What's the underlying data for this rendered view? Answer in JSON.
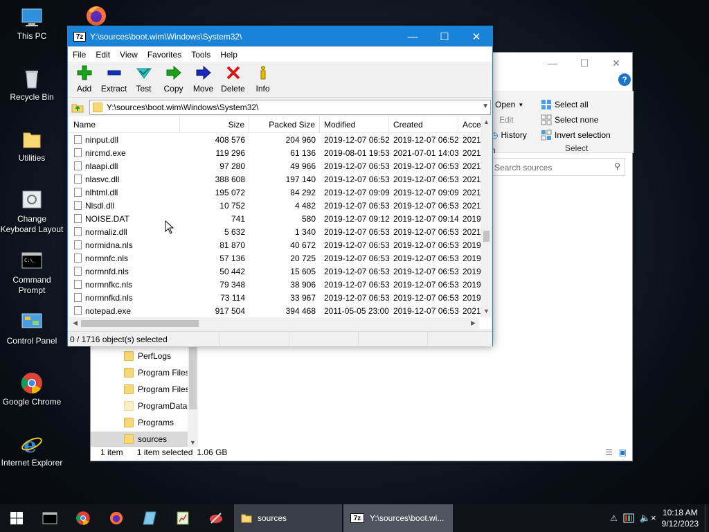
{
  "desktop": {
    "icons": [
      {
        "label": "This PC"
      },
      {
        "label": "Recycle Bin"
      },
      {
        "label": "Utilities"
      },
      {
        "label": "Change Keyboard Layout"
      },
      {
        "label": "Command Prompt"
      },
      {
        "label": "Control Panel"
      },
      {
        "label": "Google Chrome"
      },
      {
        "label": "Internet Explorer"
      }
    ]
  },
  "explorer": {
    "ribbon": {
      "open": "Open",
      "edit": "Edit",
      "history": "History",
      "select_all": "Select all",
      "select_none": "Select none",
      "invert_selection": "Invert selection",
      "group_select": "Select",
      "group_open_fragment": "n"
    },
    "search_placeholder": "Search sources",
    "tree": [
      "PerfLogs",
      "Program Files",
      "Program Files",
      "ProgramData",
      "Programs",
      "sources"
    ],
    "status": {
      "count": "1 item",
      "selected": "1 item selected",
      "size": "1.06 GB"
    }
  },
  "sevenzip": {
    "title": "Y:\\sources\\boot.wim\\Windows\\System32\\",
    "logo": "7z",
    "menu": [
      "File",
      "Edit",
      "View",
      "Favorites",
      "Tools",
      "Help"
    ],
    "toolbar": [
      "Add",
      "Extract",
      "Test",
      "Copy",
      "Move",
      "Delete",
      "Info"
    ],
    "address": "Y:\\sources\\boot.wim\\Windows\\System32\\",
    "columns": [
      "Name",
      "Size",
      "Packed Size",
      "Modified",
      "Created",
      "Acce"
    ],
    "rows": [
      {
        "name": "ninput.dll",
        "size": "408 576",
        "packed": "204 960",
        "modified": "2019-12-07 06:52",
        "created": "2019-12-07 06:52",
        "accessed": "2021-"
      },
      {
        "name": "nircmd.exe",
        "size": "119 296",
        "packed": "61 136",
        "modified": "2019-08-01 19:53",
        "created": "2021-07-01 14:03",
        "accessed": "2021-"
      },
      {
        "name": "nlaapi.dll",
        "size": "97 280",
        "packed": "49 966",
        "modified": "2019-12-07 06:53",
        "created": "2019-12-07 06:53",
        "accessed": "2021-"
      },
      {
        "name": "nlasvc.dll",
        "size": "388 608",
        "packed": "197 140",
        "modified": "2019-12-07 06:53",
        "created": "2019-12-07 06:53",
        "accessed": "2021-"
      },
      {
        "name": "nlhtml.dll",
        "size": "195 072",
        "packed": "84 292",
        "modified": "2019-12-07 09:09",
        "created": "2019-12-07 09:09",
        "accessed": "2021-"
      },
      {
        "name": "Nlsdl.dll",
        "size": "10 752",
        "packed": "4 482",
        "modified": "2019-12-07 06:53",
        "created": "2019-12-07 06:53",
        "accessed": "2021-"
      },
      {
        "name": "NOISE.DAT",
        "size": "741",
        "packed": "580",
        "modified": "2019-12-07 09:12",
        "created": "2019-12-07 09:14",
        "accessed": "2019-"
      },
      {
        "name": "normaliz.dll",
        "size": "5 632",
        "packed": "1 340",
        "modified": "2019-12-07 06:53",
        "created": "2019-12-07 06:53",
        "accessed": "2021-"
      },
      {
        "name": "normidna.nls",
        "size": "81 870",
        "packed": "40 672",
        "modified": "2019-12-07 06:53",
        "created": "2019-12-07 06:53",
        "accessed": "2019-"
      },
      {
        "name": "normnfc.nls",
        "size": "57 136",
        "packed": "20 725",
        "modified": "2019-12-07 06:53",
        "created": "2019-12-07 06:53",
        "accessed": "2019-"
      },
      {
        "name": "normnfd.nls",
        "size": "50 442",
        "packed": "15 605",
        "modified": "2019-12-07 06:53",
        "created": "2019-12-07 06:53",
        "accessed": "2019-"
      },
      {
        "name": "normnfkc.nls",
        "size": "79 348",
        "packed": "38 906",
        "modified": "2019-12-07 06:53",
        "created": "2019-12-07 06:53",
        "accessed": "2019-"
      },
      {
        "name": "normnfkd.nls",
        "size": "73 114",
        "packed": "33 967",
        "modified": "2019-12-07 06:53",
        "created": "2019-12-07 06:53",
        "accessed": "2019-"
      },
      {
        "name": "notepad.exe",
        "size": "917 504",
        "packed": "394 468",
        "modified": "2011-05-05 23:00",
        "created": "2019-12-07 06:53",
        "accessed": "2021-"
      }
    ],
    "status": "0 / 1716 object(s) selected"
  },
  "taskbar": {
    "apps": [
      {
        "label": "sources"
      },
      {
        "label": "Y:\\sources\\boot.wi..."
      }
    ],
    "clock": {
      "time": "10:18 AM",
      "date": "9/12/2023"
    }
  },
  "colors": {
    "accent": "#1883d7",
    "add_green": "#1aa31a",
    "delete_red": "#d11a1a",
    "folder": "#f8d775"
  }
}
